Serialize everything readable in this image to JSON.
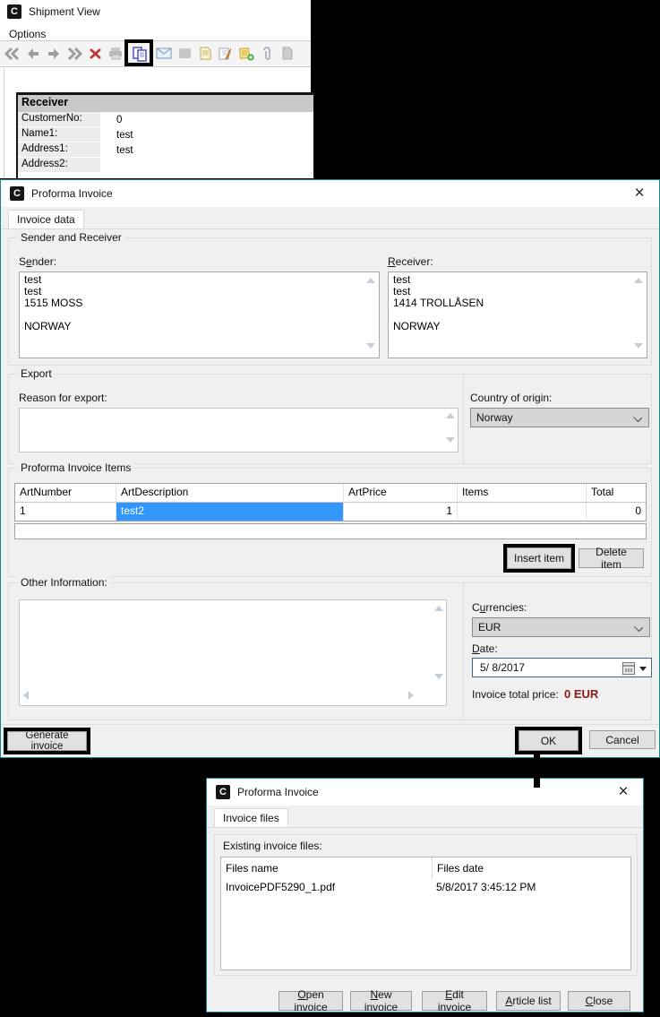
{
  "icons": {
    "close_glyph": "×",
    "app_logo_letter": "C"
  },
  "colors": {
    "teal_border": "#1e8585",
    "selection_blue": "#3297fd",
    "price_red": "#8b1a1a"
  },
  "shipment_view": {
    "title": "Shipment View",
    "menu_options": "Options",
    "toolbar": {
      "icons": [
        "first",
        "previous",
        "next",
        "last",
        "delete",
        "print",
        "copy",
        "email",
        "export",
        "document",
        "edit-note",
        "add-note",
        "attachment",
        "page"
      ]
    },
    "receiver_panel": {
      "header": "Receiver",
      "rows": [
        {
          "label": "CustomerNo:",
          "value": "0"
        },
        {
          "label": "Name1:",
          "value": "test"
        },
        {
          "label": "Address1:",
          "value": "test"
        },
        {
          "label": "Address2:",
          "value": ""
        }
      ]
    }
  },
  "invoice_dialog": {
    "title": "Proforma Invoice",
    "tab_label": "Invoice data",
    "sender_receiver": {
      "legend": "Sender and Receiver",
      "sender_label_parts": [
        "S",
        "e",
        "nder:"
      ],
      "sender_value": "test\ntest\n1515 MOSS\n\nNORWAY",
      "receiver_label_parts": [
        "",
        "R",
        "eceiver:"
      ],
      "receiver_value": "test\ntest\n1414 TROLLÅSEN\n\nNORWAY"
    },
    "export": {
      "legend": "Export",
      "reason_label": "Reason for export:",
      "reason_value": "",
      "country_label": "Country of origin:",
      "country_value": "Norway"
    },
    "items": {
      "legend": "Proforma Invoice Items",
      "columns": [
        "ArtNumber",
        "ArtDescription",
        "ArtPrice",
        "Items",
        "Total"
      ],
      "row": {
        "art_number": "1",
        "art_description": "test2",
        "art_price": "1",
        "items": "",
        "total": "0"
      },
      "insert_label": "Insert item",
      "delete_label": "Delete item"
    },
    "other": {
      "legend": "Other Information:",
      "value": "",
      "currencies_label_parts": [
        "C",
        "u",
        "rrencies:"
      ],
      "currencies_value": "EUR",
      "date_label_parts": [
        "",
        "D",
        "ate:"
      ],
      "date_value": "5/ 8/2017",
      "total_label": "Invoice total price:",
      "total_value": "0 EUR"
    },
    "generate_label": "Generate invoice",
    "ok_label": "OK",
    "cancel_label": "Cancel"
  },
  "files_dialog": {
    "title": "Proforma Invoice",
    "tab_label": "Invoice files",
    "group_label": "Existing invoice files:",
    "columns": [
      "Files name",
      "Files date"
    ],
    "row": {
      "name": "InvoicePDF5290_1.pdf",
      "date": "5/8/2017 3:45:12 PM"
    },
    "buttons": {
      "open_parts": [
        "",
        "O",
        "pen invoice"
      ],
      "new_parts": [
        "",
        "N",
        "ew invoice"
      ],
      "edit_parts": [
        "",
        "E",
        "dit invoice"
      ],
      "article_parts": [
        "",
        "A",
        "rticle list"
      ],
      "close_parts": [
        "",
        "C",
        "lose"
      ]
    }
  }
}
